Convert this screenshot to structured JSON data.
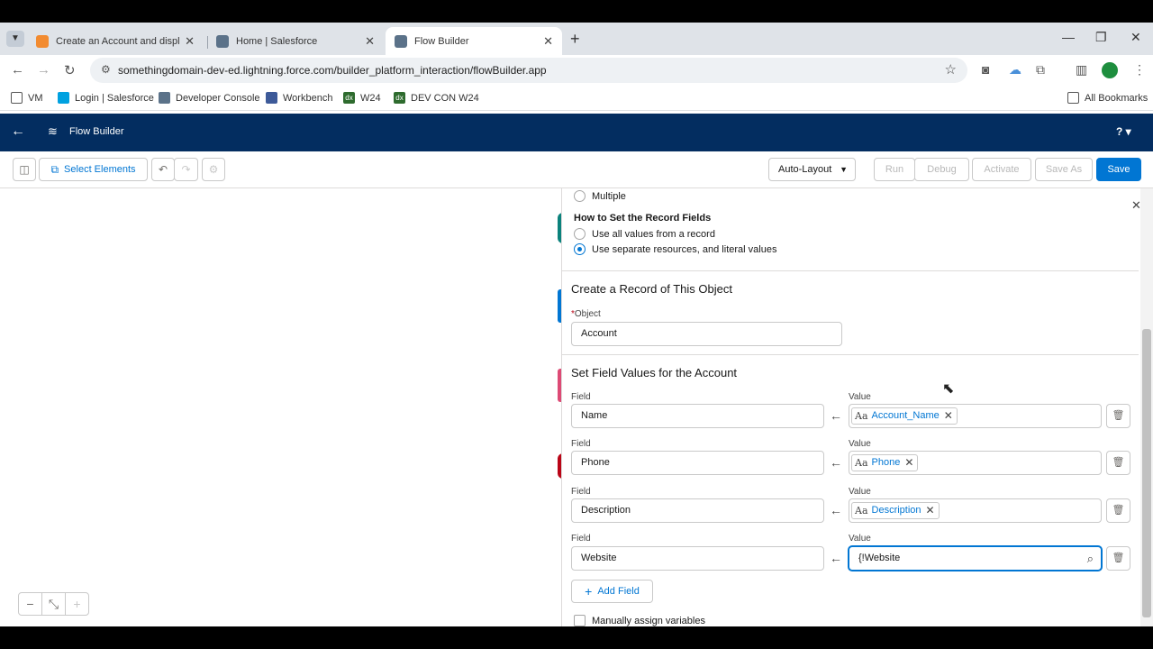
{
  "browser": {
    "tabs": [
      {
        "title": "Create an Account and display",
        "favicon_color": "#f28b30"
      },
      {
        "title": "Home | Salesforce",
        "favicon_color": "#5b7289"
      },
      {
        "title": "Flow Builder",
        "favicon_color": "#5b7289"
      }
    ],
    "url": "somethingdomain-dev-ed.lightning.force.com/builder_platform_interaction/flowBuilder.app",
    "bookmarks": [
      "VM",
      "Login | Salesforce",
      "Developer Console",
      "Workbench",
      "W24",
      "DEV CON W24"
    ],
    "all_bookmarks": "All Bookmarks"
  },
  "header": {
    "title": "Flow Builder",
    "help": "?"
  },
  "toolbar": {
    "select_elements": "Select Elements",
    "layout": "Auto-Layout",
    "run": "Run",
    "debug": "Debug",
    "activate": "Activate",
    "save_as": "Save As",
    "save": "Save"
  },
  "panel": {
    "multiple_label": "Multiple",
    "how_to_set_heading": "How to Set the Record Fields",
    "option_all_values": "Use all values from a record",
    "option_separate": "Use separate resources, and literal values",
    "create_record_heading": "Create a Record of This Object",
    "object_label": "Object",
    "object_value": "Account",
    "set_field_values_heading": "Set Field Values for the Account",
    "field_label": "Field",
    "value_label": "Value",
    "rows": [
      {
        "field": "Name",
        "value": "Account_Name"
      },
      {
        "field": "Phone",
        "value": "Phone"
      },
      {
        "field": "Description",
        "value": "Description"
      },
      {
        "field": "Website",
        "value": "{!Website"
      }
    ],
    "add_field": "Add Field",
    "manually_assign": "Manually assign variables"
  },
  "colors": {
    "header_bg": "#032d60",
    "brand": "#0176d3"
  }
}
